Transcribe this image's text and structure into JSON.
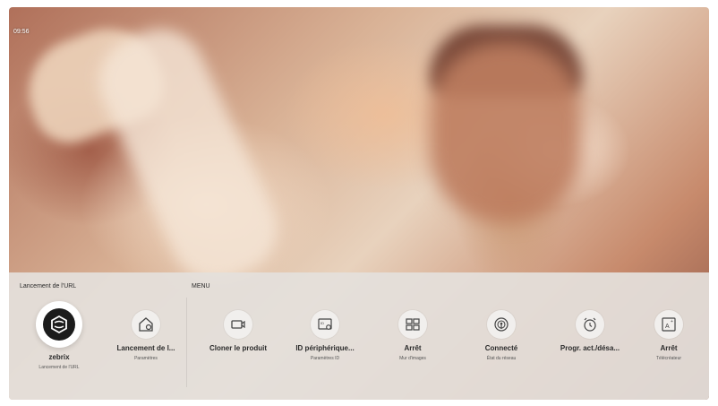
{
  "status": {
    "time": "09:56"
  },
  "panel": {
    "url_section_label": "Lancement de l'URL",
    "menu_section_label": "MENU",
    "items": [
      {
        "title": "zebrix",
        "subtitle": "Lancement de l'URL",
        "icon": "zebrix-logo-icon"
      },
      {
        "title": "Lancement de l...",
        "subtitle": "Paramètres",
        "icon": "home-gear-icon"
      },
      {
        "title": "Cloner le produit",
        "subtitle": "",
        "icon": "video-camera-icon"
      },
      {
        "title": "ID périphérique...",
        "subtitle": "Paramètres ID",
        "icon": "id-card-gear-icon"
      },
      {
        "title": "Arrêt",
        "subtitle": "Mur d'images",
        "icon": "video-wall-icon"
      },
      {
        "title": "Connecté",
        "subtitle": "État du réseau",
        "icon": "network-broadcast-icon"
      },
      {
        "title": "Progr. act./désa...",
        "subtitle": "",
        "icon": "alarm-clock-icon"
      },
      {
        "title": "Arrêt",
        "subtitle": "Télécréateur",
        "icon": "text-screen-icon"
      }
    ]
  }
}
